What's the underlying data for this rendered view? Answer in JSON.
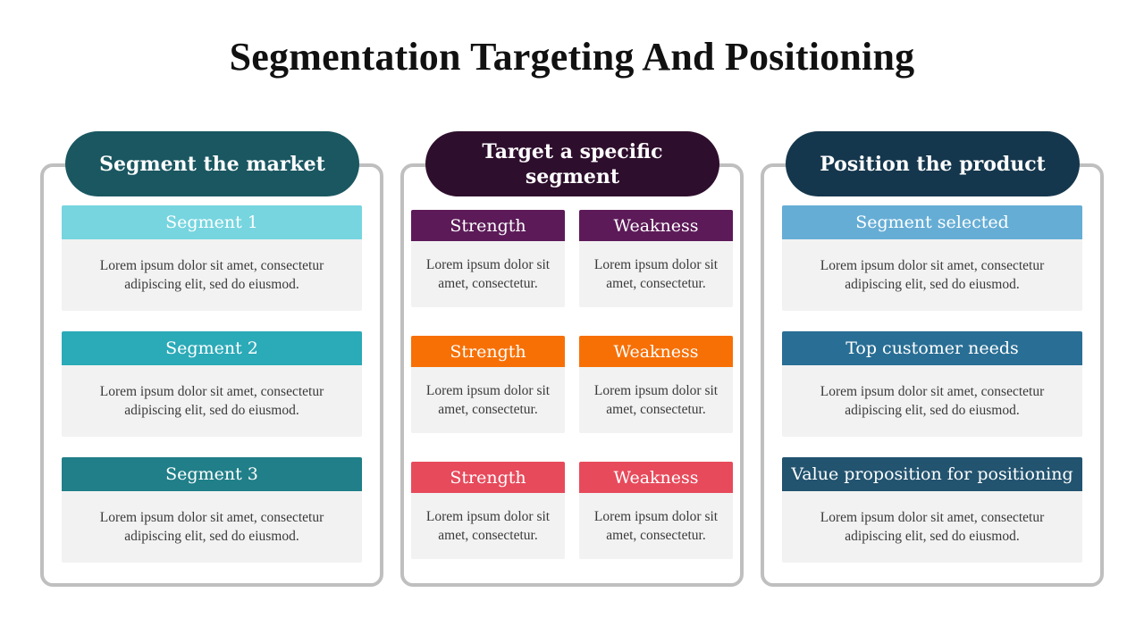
{
  "title": "Segmentation Targeting And Positioning",
  "columns": [
    {
      "heading": "Segment the market",
      "color": "#1a5761",
      "cards": [
        {
          "label": "Segment 1",
          "color": "#76d5df",
          "text": "Lorem ipsum dolor sit amet, consectetur adipiscing elit, sed do eiusmod."
        },
        {
          "label": "Segment 2",
          "color": "#2baab8",
          "text": "Lorem ipsum dolor sit amet, consectetur adipiscing elit, sed do eiusmod."
        },
        {
          "label": "Segment 3",
          "color": "#207f88",
          "text": "Lorem ipsum dolor sit amet, consectetur adipiscing elit, sed do eiusmod."
        }
      ]
    },
    {
      "heading": "Target a specific segment",
      "color": "#2e0e2d",
      "rows": [
        {
          "color": "#5c1a58",
          "cards": [
            {
              "label": "Strength",
              "text": "Lorem ipsum dolor sit amet, consectetur."
            },
            {
              "label": "Weakness",
              "text": "Lorem ipsum dolor sit amet, consectetur."
            }
          ]
        },
        {
          "color": "#f77006",
          "cards": [
            {
              "label": "Strength",
              "text": "Lorem ipsum dolor sit amet, consectetur."
            },
            {
              "label": "Weakness",
              "text": "Lorem ipsum dolor sit amet, consectetur."
            }
          ]
        },
        {
          "color": "#e74a5b",
          "cards": [
            {
              "label": "Strength",
              "text": "Lorem ipsum dolor sit amet, consectetur."
            },
            {
              "label": "Weakness",
              "text": "Lorem ipsum dolor sit amet, consectetur."
            }
          ]
        }
      ]
    },
    {
      "heading": "Position the product",
      "color": "#15374d",
      "cards": [
        {
          "label": "Segment selected",
          "color": "#65add5",
          "text": "Lorem ipsum dolor sit amet, consectetur adipiscing elit, sed do eiusmod."
        },
        {
          "label": "Top customer needs",
          "color": "#296e95",
          "text": "Lorem ipsum dolor sit amet, consectetur adipiscing elit, sed do eiusmod."
        },
        {
          "label": "Value proposition for positioning",
          "color": "#22536f",
          "text": "Lorem ipsum dolor sit amet, consectetur adipiscing elit, sed do eiusmod."
        }
      ]
    }
  ]
}
